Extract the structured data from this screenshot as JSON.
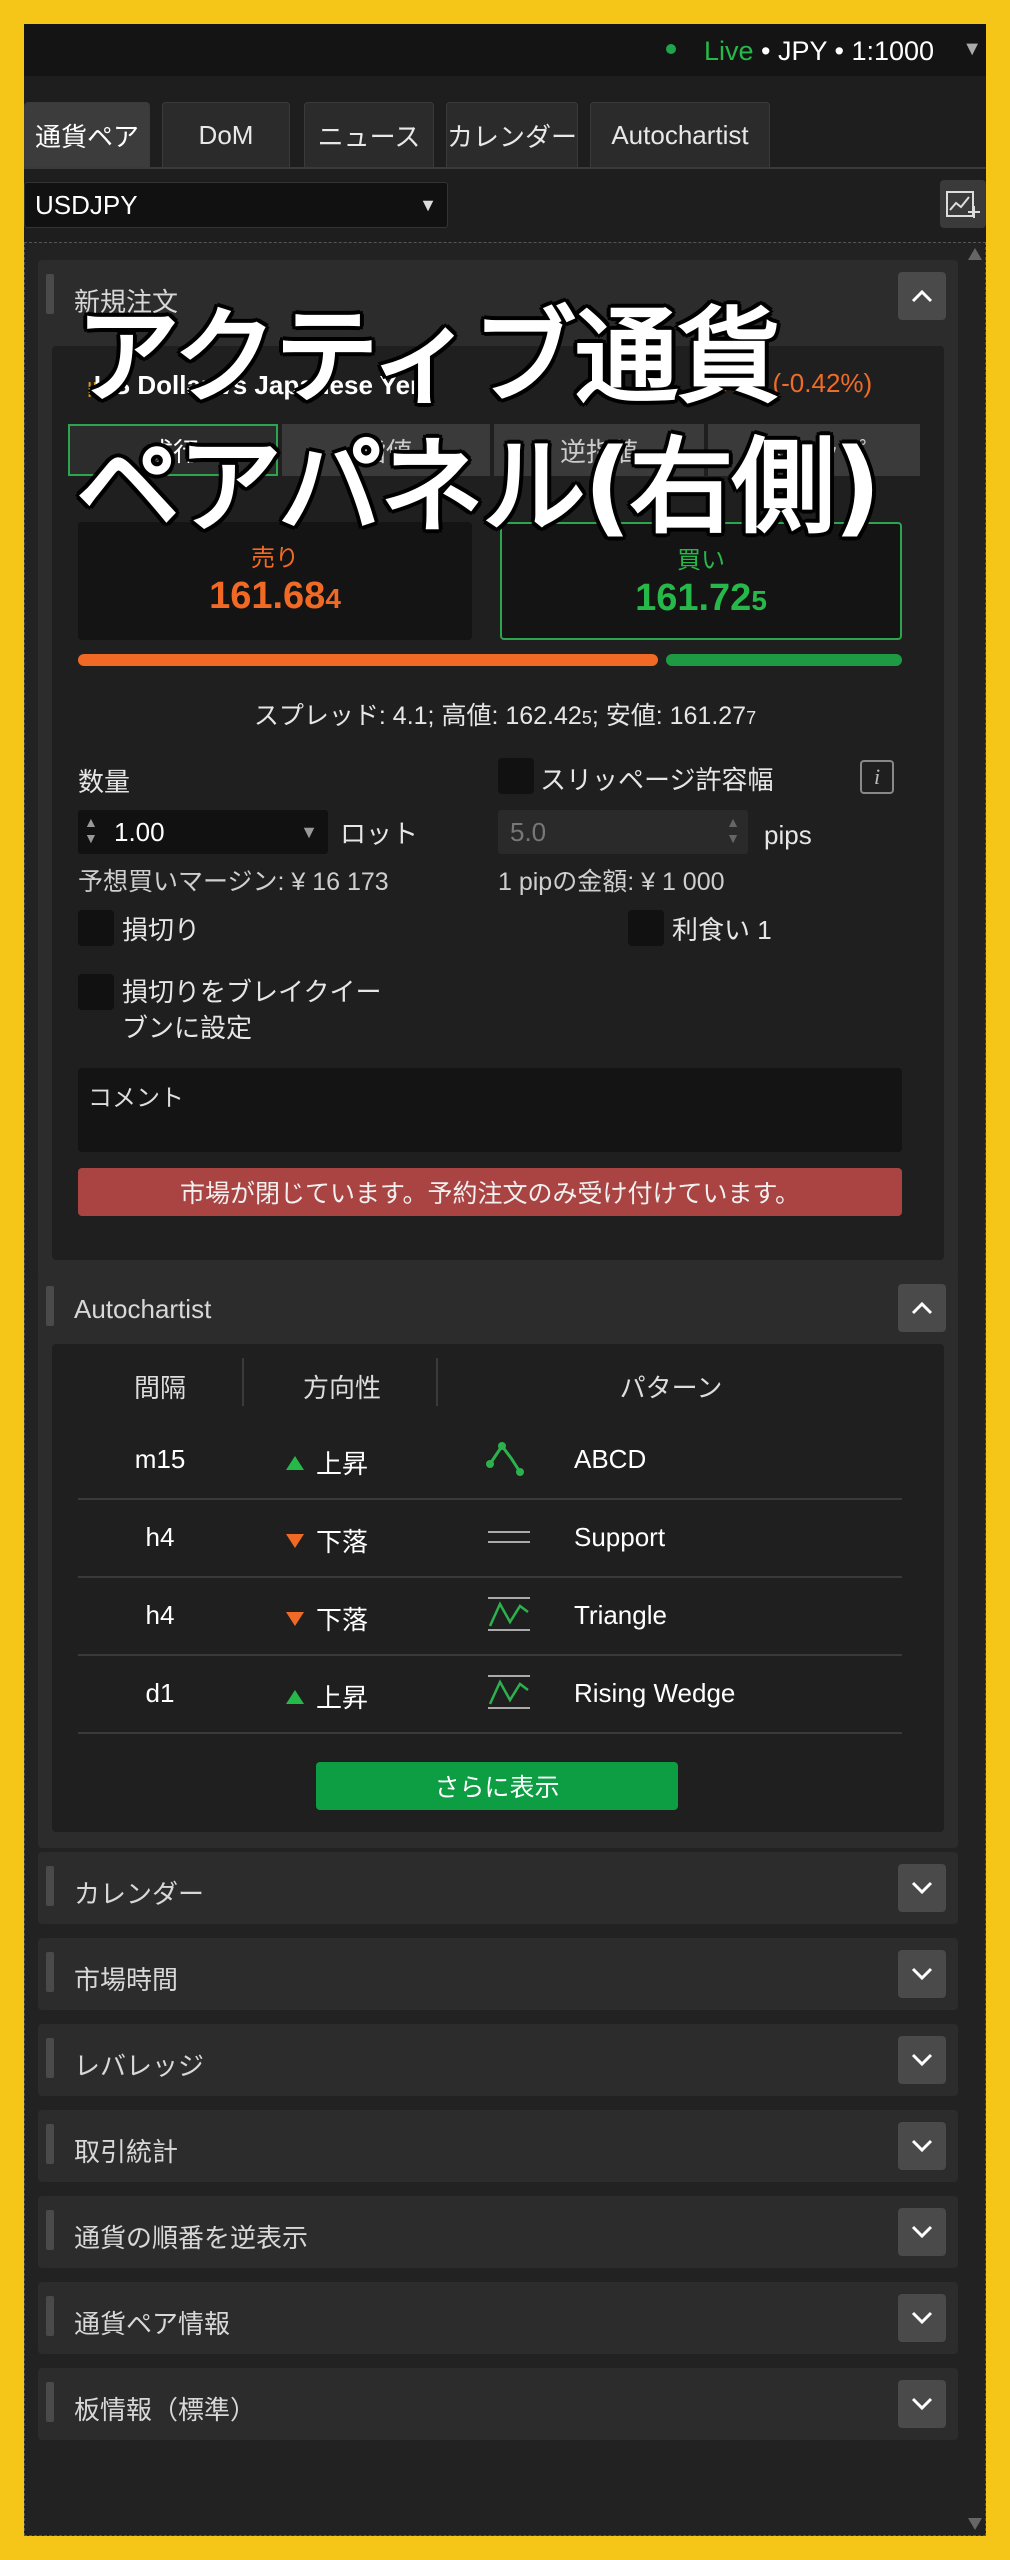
{
  "status": {
    "live": "Live",
    "rest": " • JPY • 1:1000"
  },
  "tabs": [
    "通貨ペア",
    "DoM",
    "ニュース",
    "カレンダー",
    "Autochartist"
  ],
  "symbol": "USDJPY",
  "new_order": {
    "title": "新規注文",
    "pair_name": "US Dollar vs Japanese Yen",
    "change": "-67.7 (-0.42%)",
    "order_types": [
      "成行",
      "指値",
      "逆指値",
      "ストップ"
    ],
    "sell": {
      "label": "売り",
      "price_main": "161.68",
      "price_pip": "4"
    },
    "buy": {
      "label": "買い",
      "price_main": "161.72",
      "price_pip": "5"
    },
    "sell_ratio": 0.71,
    "spread": {
      "a": "スプレッド: 4.1; 高値: 162.42",
      "a_small": "5",
      "b": "; 安値: 161.27",
      "b_small": "7"
    },
    "quantity_label": "数量",
    "quantity_value": "1.00",
    "unit": "ロット",
    "margin": "予想買いマージン: ¥ 16 173",
    "slippage_label": "スリッページ許容幅",
    "slippage_value": "5.0",
    "pips": "pips",
    "pip_value": "1 pipの金額: ¥ 1 000",
    "stop_loss": "損切り",
    "take_profit": "利食い 1",
    "breakeven_line1": "損切りをブレイクイー",
    "breakeven_line2": "ブンに設定",
    "comment_placeholder": "コメント",
    "market_closed": "市場が閉じています。予約注文のみ受け付けています。"
  },
  "overlay": {
    "line1": "アクティブ通貨",
    "line2": "ペアパネル(右側)"
  },
  "autochartist": {
    "title": "Autochartist",
    "headers": [
      "間隔",
      "方向性",
      "パターン"
    ],
    "rows": [
      {
        "interval": "m15",
        "direction": "上昇",
        "trend": "up",
        "pattern": "ABCD",
        "icon": "abcd-pattern-icon"
      },
      {
        "interval": "h4",
        "direction": "下落",
        "trend": "down",
        "pattern": "Support",
        "icon": "support-pattern-icon"
      },
      {
        "interval": "h4",
        "direction": "下落",
        "trend": "down",
        "pattern": "Triangle",
        "icon": "triangle-pattern-icon"
      },
      {
        "interval": "d1",
        "direction": "上昇",
        "trend": "up",
        "pattern": "Rising Wedge",
        "icon": "wedge-pattern-icon"
      }
    ],
    "more": "さらに表示"
  },
  "sections": [
    "カレンダー",
    "市場時間",
    "レバレッジ",
    "取引統計",
    "通貨の順番を逆表示",
    "通貨ペア情報",
    "板情報（標準）"
  ],
  "colors": {
    "sell": "#f06a25",
    "buy": "#27b84a",
    "warning": "#a94442",
    "accent": "#0d9e44"
  }
}
